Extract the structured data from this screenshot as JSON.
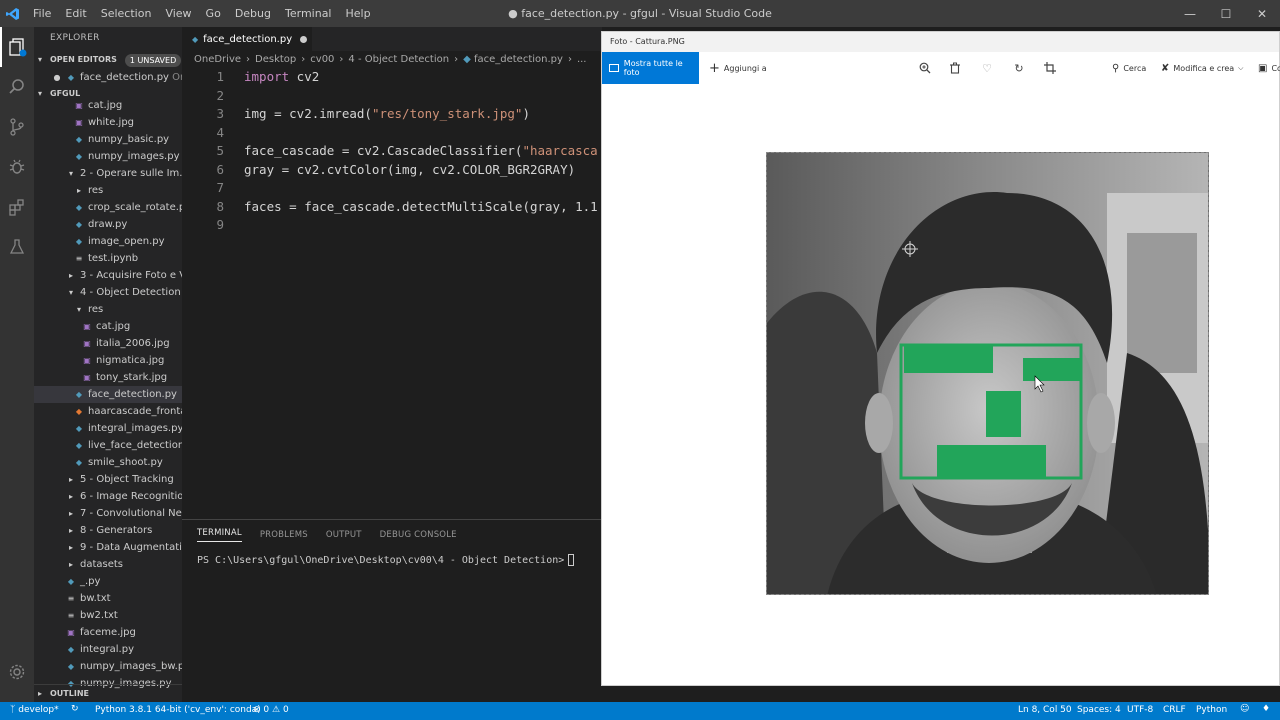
{
  "titlebar": {
    "menu": [
      "File",
      "Edit",
      "Selection",
      "View",
      "Go",
      "Debug",
      "Terminal",
      "Help"
    ],
    "title": "● face_detection.py - gfgul - Visual Studio Code"
  },
  "sidebar": {
    "header": "EXPLORER",
    "open_editors": "OPEN EDITORS",
    "unsaved_badge": "1 UNSAVED",
    "open_file": "face_detection.py",
    "open_file_hint": "On...",
    "root": "GFGUL",
    "items": [
      {
        "label": "cat.jpg",
        "type": "img",
        "indent": 3
      },
      {
        "label": "white.jpg",
        "type": "img",
        "indent": 3
      },
      {
        "label": "numpy_basic.py",
        "type": "py",
        "indent": 3
      },
      {
        "label": "numpy_images.py",
        "type": "py",
        "indent": 3
      },
      {
        "label": "2 - Operare sulle Im...",
        "type": "folder-open",
        "indent": 2
      },
      {
        "label": "res",
        "type": "folder",
        "indent": 3
      },
      {
        "label": "crop_scale_rotate.py",
        "type": "py",
        "indent": 3
      },
      {
        "label": "draw.py",
        "type": "py",
        "indent": 3
      },
      {
        "label": "image_open.py",
        "type": "py",
        "indent": 3
      },
      {
        "label": "test.ipynb",
        "type": "txt",
        "indent": 3
      },
      {
        "label": "3 - Acquisire Foto e V...",
        "type": "folder",
        "indent": 2
      },
      {
        "label": "4 - Object Detection",
        "type": "folder-open",
        "indent": 2
      },
      {
        "label": "res",
        "type": "folder-open",
        "indent": 3
      },
      {
        "label": "cat.jpg",
        "type": "img",
        "indent": 4
      },
      {
        "label": "italia_2006.jpg",
        "type": "img",
        "indent": 4
      },
      {
        "label": "nigmatica.jpg",
        "type": "img",
        "indent": 4
      },
      {
        "label": "tony_stark.jpg",
        "type": "img",
        "indent": 4
      },
      {
        "label": "face_detection.py",
        "type": "py",
        "indent": 3,
        "selected": true
      },
      {
        "label": "haarcascade_frontal...",
        "type": "xml",
        "indent": 3
      },
      {
        "label": "integral_images.py",
        "type": "py",
        "indent": 3
      },
      {
        "label": "live_face_detection.py",
        "type": "py",
        "indent": 3
      },
      {
        "label": "smile_shoot.py",
        "type": "py",
        "indent": 3
      },
      {
        "label": "5 - Object Tracking",
        "type": "folder",
        "indent": 2
      },
      {
        "label": "6 - Image Recognition",
        "type": "folder",
        "indent": 2
      },
      {
        "label": "7 - Convolutional Ne...",
        "type": "folder",
        "indent": 2
      },
      {
        "label": "8 - Generators",
        "type": "folder",
        "indent": 2
      },
      {
        "label": "9 - Data Augmentation",
        "type": "folder",
        "indent": 2
      },
      {
        "label": "datasets",
        "type": "folder",
        "indent": 2
      },
      {
        "label": "_.py",
        "type": "py",
        "indent": 2
      },
      {
        "label": "bw.txt",
        "type": "txt",
        "indent": 2
      },
      {
        "label": "bw2.txt",
        "type": "txt",
        "indent": 2
      },
      {
        "label": "faceme.jpg",
        "type": "img",
        "indent": 2
      },
      {
        "label": "integral.py",
        "type": "py",
        "indent": 2
      },
      {
        "label": "numpy_images_bw.py",
        "type": "py",
        "indent": 2
      },
      {
        "label": "numpy_images.py",
        "type": "py",
        "indent": 2
      }
    ],
    "outline": "OUTLINE"
  },
  "editor": {
    "tab_label": "face_detection.py",
    "breadcrumb": [
      "OneDrive",
      "Desktop",
      "cv00",
      "4 - Object Detection",
      "face_detection.py",
      "..."
    ],
    "lines": [
      {
        "n": "1",
        "parts": [
          [
            "kw",
            "import"
          ],
          [
            "",
            " cv2"
          ]
        ]
      },
      {
        "n": "2",
        "parts": []
      },
      {
        "n": "3",
        "parts": [
          [
            "",
            "img = cv2.imread("
          ],
          [
            "str",
            "\"res/tony_stark.jpg\""
          ],
          [
            "",
            ")"
          ]
        ]
      },
      {
        "n": "4",
        "parts": []
      },
      {
        "n": "5",
        "parts": [
          [
            "",
            "face_cascade = cv2.CascadeClassifier("
          ],
          [
            "str",
            "\"haarcasca"
          ]
        ]
      },
      {
        "n": "6",
        "parts": [
          [
            "",
            "gray = cv2.cvtColor(img, cv2.COLOR_BGR2GRAY)"
          ]
        ]
      },
      {
        "n": "7",
        "parts": []
      },
      {
        "n": "8",
        "parts": [
          [
            "",
            "faces = face_cascade.detectMultiScale(gray, 1.1"
          ]
        ]
      },
      {
        "n": "9",
        "parts": []
      }
    ]
  },
  "panel": {
    "tabs": [
      "TERMINAL",
      "PROBLEMS",
      "OUTPUT",
      "DEBUG CONSOLE"
    ],
    "prompt": "PS C:\\Users\\gfgul\\OneDrive\\Desktop\\cv00\\4 - Object Detection>"
  },
  "photos": {
    "title": "Foto - Cattura.PNG",
    "show_all": "Mostra tutte le foto",
    "add_to": "Aggiungi a",
    "search": "Cerca",
    "edit_create": "Modifica e crea",
    "more": "Co"
  },
  "statusbar": {
    "branch": "develop*",
    "python": "Python 3.8.1 64-bit ('cv_env': conda)",
    "errors": "0",
    "warnings": "0",
    "position": "Ln 8, Col 50",
    "spaces": "Spaces: 4",
    "encoding": "UTF-8",
    "eol": "CRLF",
    "language": "Python"
  },
  "colors": {
    "statusbar": "#007acc",
    "accent": "#0078d7",
    "detection": "#22a55a"
  }
}
